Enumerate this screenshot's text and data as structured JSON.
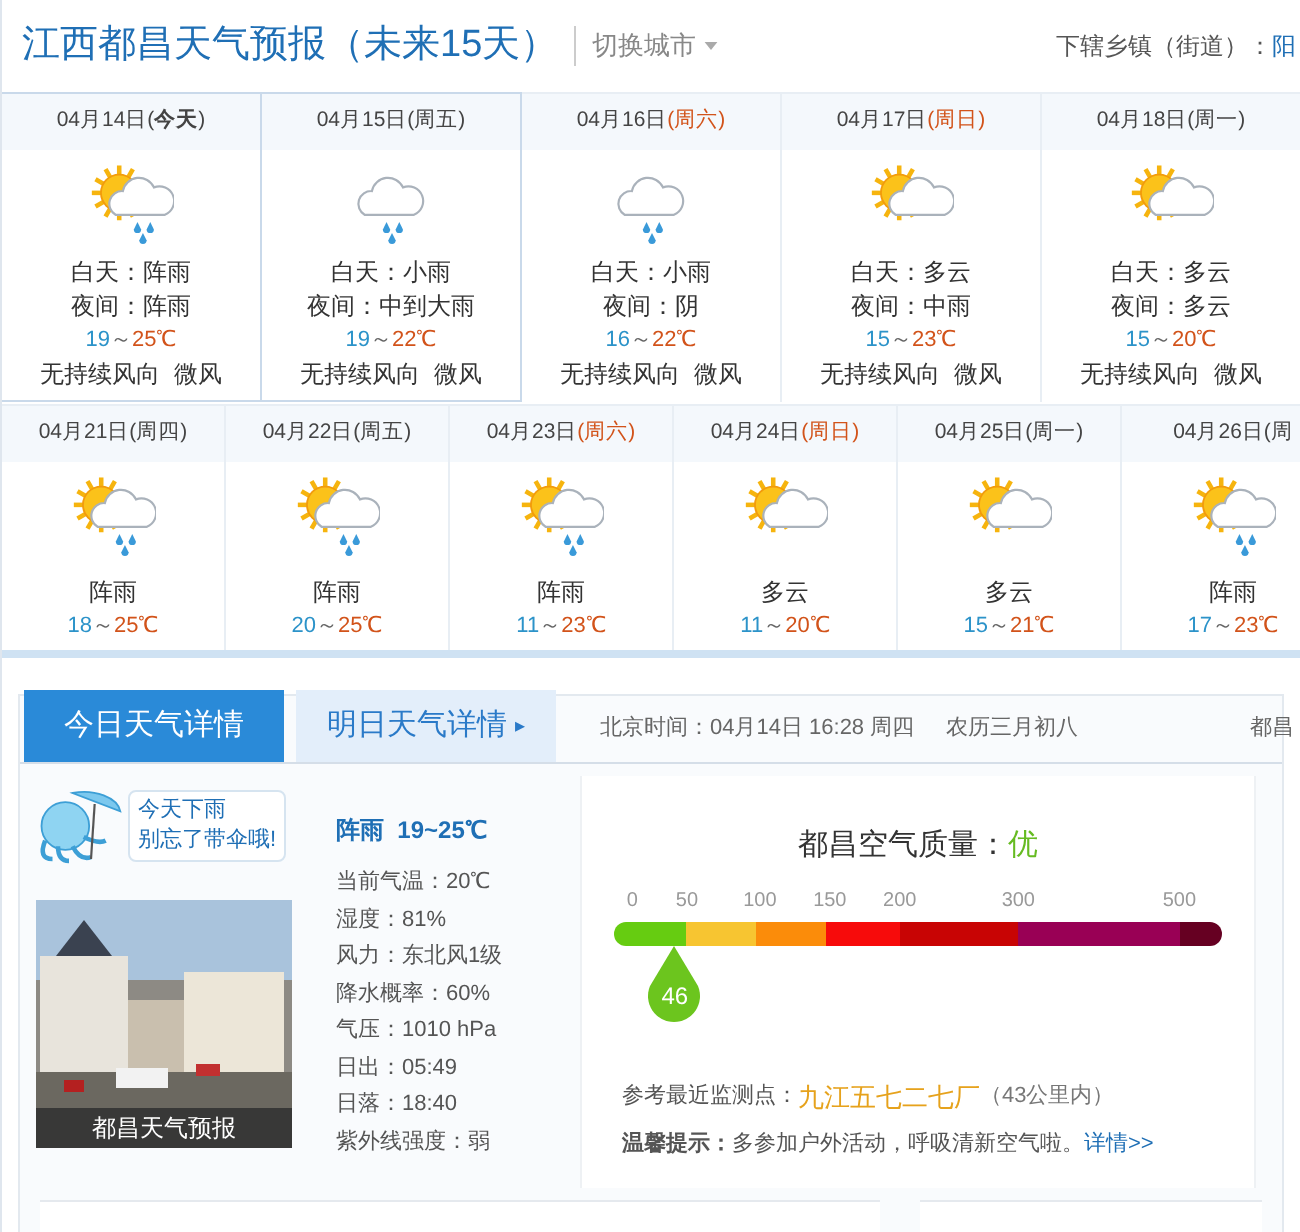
{
  "header": {
    "title": "江西都昌天气预报（未来15天）",
    "switch_city": "切换城市",
    "sub_label": "下辖乡镇（街道）：",
    "sub_link": "阳"
  },
  "forecast_top": [
    {
      "date": "04月14日",
      "weekday": "(**今天**)",
      "weekend": false,
      "selected": true,
      "kind": "sun_cloud_rain",
      "day": "白天：阵雨",
      "night": "夜间：阵雨",
      "low": "19",
      "sep": "～",
      "high": "25℃",
      "wind": "无持续风向  微风"
    },
    {
      "date": "04月15日",
      "weekday": "(周五)",
      "weekend": false,
      "selected": true,
      "kind": "cloud_rain",
      "day": "白天：小雨",
      "night": "夜间：中到大雨",
      "low": "19",
      "sep": "～",
      "high": "22℃",
      "wind": "无持续风向  微风"
    },
    {
      "date": "04月16日",
      "weekday": "(周六)",
      "weekend": true,
      "selected": false,
      "kind": "cloud_rain",
      "day": "白天：小雨",
      "night": "夜间：阴",
      "low": "16",
      "sep": "～",
      "high": "22℃",
      "wind": "无持续风向  微风"
    },
    {
      "date": "04月17日",
      "weekday": "(周日)",
      "weekend": true,
      "selected": false,
      "kind": "sun_cloud",
      "day": "白天：多云",
      "night": "夜间：中雨",
      "low": "15",
      "sep": "～",
      "high": "23℃",
      "wind": "无持续风向  微风"
    },
    {
      "date": "04月18日",
      "weekday": "(周一)",
      "weekend": false,
      "selected": false,
      "kind": "sun_cloud",
      "day": "白天：多云",
      "night": "夜间：多云",
      "low": "15",
      "sep": "～",
      "high": "20℃",
      "wind": "无持续风向  微风"
    }
  ],
  "forecast_bottom": [
    {
      "date": "04月21日",
      "weekday": "(周四)",
      "weekend": false,
      "kind": "sun_cloud_rain",
      "condition": "阵雨",
      "low": "18",
      "sep": "～",
      "high": "25℃"
    },
    {
      "date": "04月22日",
      "weekday": "(周五)",
      "weekend": false,
      "kind": "sun_cloud_rain",
      "condition": "阵雨",
      "low": "20",
      "sep": "～",
      "high": "25℃"
    },
    {
      "date": "04月23日",
      "weekday": "(周六)",
      "weekend": true,
      "kind": "sun_cloud_rain",
      "condition": "阵雨",
      "low": "11",
      "sep": "～",
      "high": "23℃"
    },
    {
      "date": "04月24日",
      "weekday": "(周日)",
      "weekend": true,
      "kind": "sun_cloud",
      "condition": "多云",
      "low": "11",
      "sep": "～",
      "high": "20℃"
    },
    {
      "date": "04月25日",
      "weekday": "(周一)",
      "weekend": false,
      "kind": "sun_cloud",
      "condition": "多云",
      "low": "15",
      "sep": "～",
      "high": "21℃"
    },
    {
      "date": "04月26日",
      "weekday": "(周",
      "weekend": false,
      "kind": "sun_cloud_rain",
      "condition": "阵雨",
      "low": "17",
      "sep": "～",
      "high": "23℃"
    }
  ],
  "tabs": [
    {
      "label": "今日天气详情",
      "selected": true
    },
    {
      "label": "明日天气详情",
      "selected": false,
      "arrow": "▸"
    }
  ],
  "info_bar": {
    "time": "北京时间：04月14日 16:28 周四",
    "lunar": "农历三月初八",
    "right": "都昌"
  },
  "tip_bubble": [
    "今天下雨",
    "别忘了带伞哦!"
  ],
  "photo_caption": "都昌天气预报",
  "today": {
    "summary": "阵雨  19~25℃",
    "details": [
      "当前气温：20℃",
      "湿度：81%",
      "风力：东北风1级",
      "降水概率：60%",
      "气压：1010 hPa",
      "日出：05:49",
      "日落：18:40",
      "紫外线强度：弱"
    ]
  },
  "air_quality": {
    "title": "都昌空气质量：",
    "grade": "优",
    "ticks": [
      "0",
      "50",
      "100",
      "150",
      "200",
      "300",
      "500"
    ],
    "segments": [
      {
        "color": "#66cc11"
      },
      {
        "color": "#f7c531"
      },
      {
        "color": "#fb8c0a"
      },
      {
        "color": "#f70b0b"
      },
      {
        "color": "#c80404"
      },
      {
        "color": "#990055"
      },
      {
        "color": "#660022"
      }
    ],
    "value": "46",
    "level": 0.1,
    "station_label": "参考最近监测点：",
    "station": "九江五七二七厂",
    "distance": "（43公里内）",
    "tip": "**温馨提示：**多参加户外活动，呼吸清新空气啦。",
    "tip_link": "详情>>"
  }
}
